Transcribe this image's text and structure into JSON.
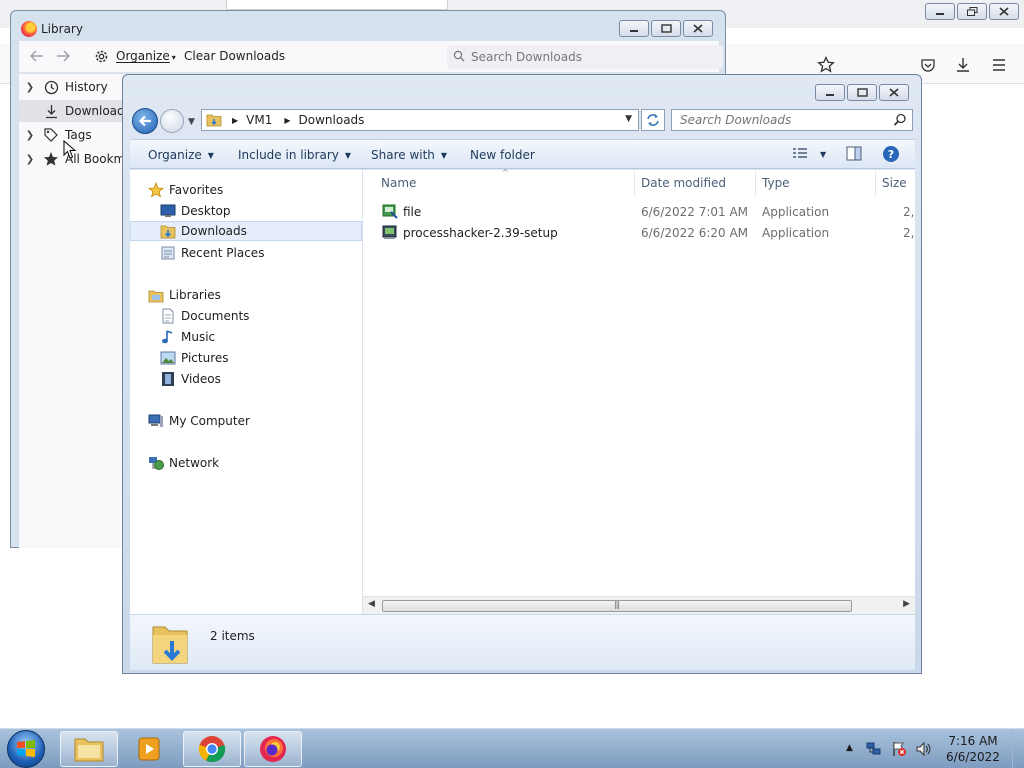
{
  "browser": {
    "toolbar_icons": [
      "star-icon",
      "pocket-icon",
      "download-icon",
      "menu-icon"
    ]
  },
  "library": {
    "title": "Library",
    "toolbar": {
      "organize": "Organize",
      "clear_downloads": "Clear Downloads",
      "search_placeholder": "Search Downloads"
    },
    "tree": [
      {
        "label": "History",
        "icon": "clock-icon",
        "expandable": true
      },
      {
        "label": "Downloads",
        "icon": "download-icon",
        "selected": true
      },
      {
        "label": "Tags",
        "icon": "tag-icon",
        "expandable": true
      },
      {
        "label": "All Bookma",
        "icon": "star-icon",
        "expandable": true
      }
    ]
  },
  "explorer": {
    "breadcrumb": [
      "VM1",
      "Downloads"
    ],
    "search_placeholder": "Search Downloads",
    "commands": {
      "organize": "Organize",
      "include_in_library": "Include in library",
      "share_with": "Share with",
      "new_folder": "New folder"
    },
    "nav": {
      "favorites": {
        "label": "Favorites",
        "items": [
          "Desktop",
          "Downloads",
          "Recent Places"
        ]
      },
      "libraries": {
        "label": "Libraries",
        "items": [
          "Documents",
          "Music",
          "Pictures",
          "Videos"
        ]
      },
      "computer": "My Computer",
      "network": "Network"
    },
    "columns": {
      "name": "Name",
      "date": "Date modified",
      "type": "Type",
      "size": "Size"
    },
    "files": [
      {
        "name": "file",
        "date": "6/6/2022 7:01 AM",
        "type": "Application",
        "size": "2,"
      },
      {
        "name": "processhacker-2.39-setup",
        "date": "6/6/2022 6:20 AM",
        "type": "Application",
        "size": "2,"
      }
    ],
    "status": {
      "count": "2 items"
    }
  },
  "taskbar": {
    "clock": {
      "time": "7:16 AM",
      "date": "6/6/2022"
    }
  }
}
